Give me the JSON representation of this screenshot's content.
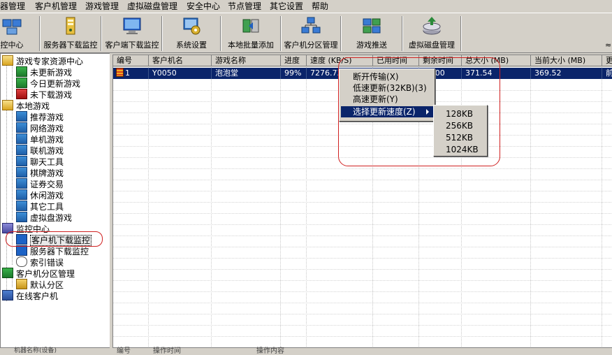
{
  "menubar": [
    "器管理",
    "客户机管理",
    "游戏管理",
    "虚拟磁盘管理",
    "安全中心",
    "节点管理",
    "其它设置",
    "帮助"
  ],
  "toolbar": [
    "控中心",
    "服务器下载监控",
    "客户端下载监控",
    "系统设置",
    "本地批量添加",
    "客户机分区管理",
    "游戏推送",
    "虚拟磁盘管理"
  ],
  "tree": [
    {
      "label": "游戏专家资源中心",
      "icon": "folder-icon"
    },
    {
      "label": "未更新游戏",
      "icon": "monitor-green-icon"
    },
    {
      "label": "今日更新游戏",
      "icon": "monitor-green-icon"
    },
    {
      "label": "未下载游戏",
      "icon": "monitor-red-icon"
    },
    {
      "label": "本地游戏",
      "icon": "folder-icon"
    },
    {
      "label": "推荐游戏",
      "icon": "game-icon"
    },
    {
      "label": "网络游戏",
      "icon": "game-icon"
    },
    {
      "label": "单机游戏",
      "icon": "game-icon"
    },
    {
      "label": "联机游戏",
      "icon": "game-icon"
    },
    {
      "label": "聊天工具",
      "icon": "game-icon"
    },
    {
      "label": "棋牌游戏",
      "icon": "game-icon"
    },
    {
      "label": "证券交易",
      "icon": "game-icon"
    },
    {
      "label": "休闲游戏",
      "icon": "game-icon"
    },
    {
      "label": "其它工具",
      "icon": "game-icon"
    },
    {
      "label": "虚拟盘游戏",
      "icon": "game-icon"
    },
    {
      "label": "监控中心",
      "icon": "monitor-center-icon"
    },
    {
      "label": "客户机下载监控",
      "icon": "client-download-icon"
    },
    {
      "label": "服务器下载监控",
      "icon": "server-download-icon"
    },
    {
      "label": "索引错误",
      "icon": "index-error-icon"
    },
    {
      "label": "客户机分区管理",
      "icon": "partition-icon"
    },
    {
      "label": "默认分区",
      "icon": "lock-icon"
    },
    {
      "label": "在线客户机",
      "icon": "online-client-icon"
    }
  ],
  "table": {
    "headers": [
      "编号",
      "客户机名",
      "游戏名称",
      "进度",
      "速度 (KB/S)",
      "已用时间",
      "剩余时间",
      "总大小 (MB)",
      "当前大小 (MB)",
      "更"
    ],
    "row": [
      "1",
      "Y0050",
      "泡泡堂",
      "99%",
      "7276.73",
      "",
      "00:00",
      "371.54",
      "369.52",
      "前"
    ]
  },
  "context_menu": {
    "items": [
      "断开传输(X)",
      "低速更新(32KB)(3)",
      "高速更新(Y)",
      "选择更新速度(Z)"
    ],
    "submenu": [
      "128KB",
      "256KB",
      "512KB",
      "1024KB"
    ]
  },
  "statusbar": [
    "机器名称(设备)",
    "编号",
    "操作时间",
    "操作内容"
  ],
  "colors": {
    "selection": "#0a246a",
    "window": "#d4d0c8",
    "annotation": "#d02020"
  }
}
